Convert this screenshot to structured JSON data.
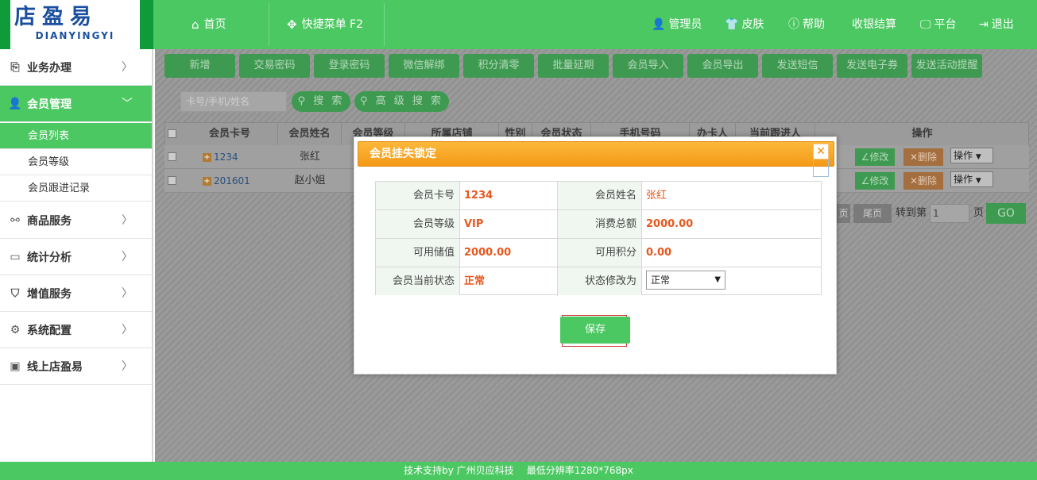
{
  "brand": {
    "logo_text": "店盈易",
    "logo_sub": "DIANYINGYI"
  },
  "topnav": {
    "home": "首页",
    "quick_menu": "快捷菜单 F2",
    "admin": "管理员",
    "skin": "皮肤",
    "help": "帮助",
    "checkout": "收银结算",
    "platform": "平台",
    "logout": "退出"
  },
  "sidebar": {
    "items": [
      {
        "label": "业务办理",
        "icon": "business-icon"
      },
      {
        "label": "会员管理",
        "icon": "member-icon"
      },
      {
        "label": "商品服务",
        "icon": "goods-icon"
      },
      {
        "label": "统计分析",
        "icon": "stats-icon"
      },
      {
        "label": "增值服务",
        "icon": "value-added-icon"
      },
      {
        "label": "系统配置",
        "icon": "settings-icon"
      },
      {
        "label": "线上店盈易",
        "icon": "online-icon"
      }
    ],
    "sub_items": [
      "会员列表",
      "会员等级",
      "会员跟进记录"
    ]
  },
  "toolbar": {
    "buttons": [
      "新增",
      "交易密码",
      "登录密码",
      "微信解绑",
      "积分清零",
      "批量延期",
      "会员导入",
      "会员导出",
      "发送短信",
      "发送电子券",
      "发送活动提醒"
    ]
  },
  "search": {
    "placeholder": "卡号/手机/姓名",
    "search_label": "搜 索",
    "advanced_label": "高 级 搜 索"
  },
  "table": {
    "headers": [
      "会员卡号",
      "会员姓名",
      "会员等级",
      "所属店铺",
      "性别",
      "会员状态",
      "手机号码",
      "办卡人",
      "当前跟进人",
      "操作"
    ],
    "rows": [
      {
        "card": "1234",
        "name": "张红"
      },
      {
        "card": "201601",
        "name": "赵小姐"
      }
    ],
    "edit_label": "修改",
    "delete_label": "删除",
    "ops_label": "操作"
  },
  "pager": {
    "prev_partial": "页",
    "last": "尾页",
    "goto_label": "转到第",
    "page_value": "1",
    "page_unit": "页",
    "go": "GO"
  },
  "modal": {
    "title": "会员挂失锁定",
    "fields": {
      "card_label": "会员卡号",
      "card_value": "1234",
      "name_label": "会员姓名",
      "name_value": "张红",
      "level_label": "会员等级",
      "level_value": "VIP",
      "total_label": "消费总额",
      "total_value": "2000.00",
      "balance_label": "可用储值",
      "balance_value": "2000.00",
      "points_label": "可用积分",
      "points_value": "0.00",
      "status_label": "会员当前状态",
      "status_value": "正常",
      "change_label": "状态修改为",
      "change_value": "正常"
    },
    "save": "保存"
  },
  "footer": {
    "support": "技术支持by 广州贝应科技",
    "resolution": "最低分辨率1280*768px"
  },
  "colors": {
    "primary": "#4cc862",
    "modal_header": "#f7a325",
    "value_accent": "#e8571d"
  }
}
